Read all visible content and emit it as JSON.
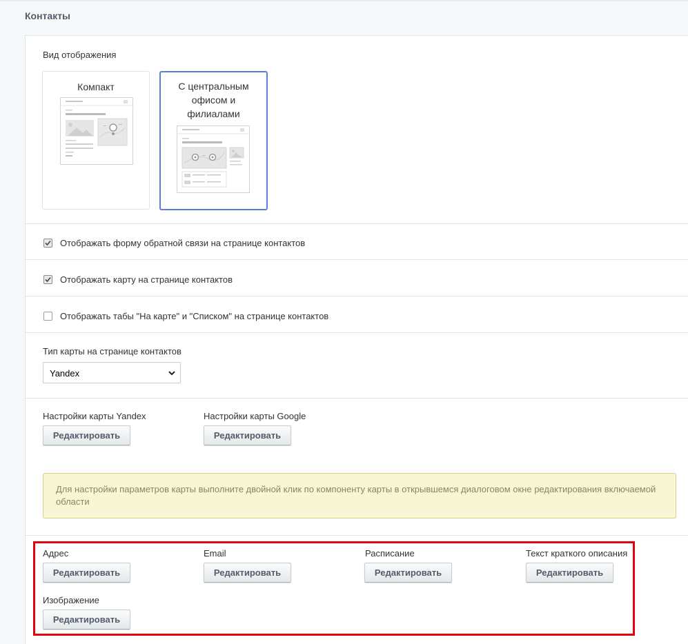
{
  "section": {
    "title": "Контакты"
  },
  "display": {
    "label": "Вид отображения",
    "options": [
      {
        "title": "Компакт",
        "selected": false
      },
      {
        "title": "С центральным офисом и филиалами",
        "title_lines": [
          "С центральным",
          "офисом и",
          "филиалами"
        ],
        "selected": true
      }
    ]
  },
  "checkboxes": [
    {
      "label": "Отображать форму обратной связи на странице контактов",
      "checked": true
    },
    {
      "label": "Отображать карту на странице контактов",
      "checked": true
    },
    {
      "label": "Отображать табы \"На карте\" и \"Списком\" на странице контактов",
      "checked": false
    }
  ],
  "map_type": {
    "label": "Тип карты на странице контактов",
    "value": "Yandex"
  },
  "map_settings": [
    {
      "label": "Настройки карты Yandex",
      "button": "Редактировать"
    },
    {
      "label": "Настройки карты Google",
      "button": "Редактировать"
    }
  ],
  "hint": {
    "text": "Для настройки параметров карты выполните двойной клик по компоненту карты в открывшемся диалоговом окне редактирования включаемой области"
  },
  "fields": [
    {
      "label": "Адрес",
      "button": "Редактировать"
    },
    {
      "label": "Email",
      "button": "Редактировать"
    },
    {
      "label": "Расписание",
      "button": "Редактировать"
    },
    {
      "label": "Текст краткого описания",
      "button": "Редактировать"
    },
    {
      "label": "Изображение",
      "button": "Редактировать"
    }
  ],
  "colors": {
    "accent": "#5b7ede",
    "highlight": "#e3000f",
    "hint_bg": "#f9f6d6"
  }
}
